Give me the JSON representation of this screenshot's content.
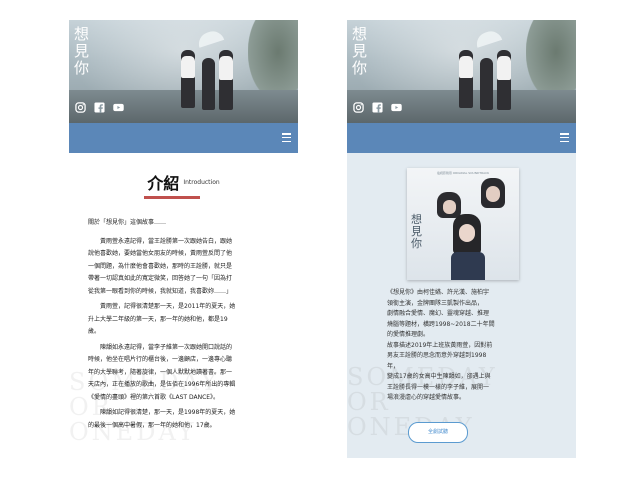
{
  "left_panel": {
    "hero": {
      "title": "想見你"
    },
    "section": {
      "title": "介紹",
      "subtitle": "Introduction"
    },
    "intro_lead": "關於「想見你」這個故事……",
    "paragraphs": [
      "黃雨萱永遠記得，當王詮勝第一次跟她告白，跟她\n說他喜歡她，要她當他女朋友的時候，黃雨萱反問了他\n一個問題，為什麼他會喜歡她，那時的王詮勝，就只是\n帶著一切認真如此的寬定微笑，回答她了一句「因為打\n從我第一眼看到你的時候，我就知道，我喜歡妳……」",
      "黃雨萱，記得很清楚那一天，是2011年的夏天，她\n升上大學二年級的第一天，那一年的她和他，都是19\n歲。",
      "陳韻如永遠記得，當李子維第一次跟她開口說話的\n時候，他坐在唱片行的櫃台後，一邊顧店，一邊專心聽\n年的大學聯考，隨著旋律，一個人默默地讀著書。那一\n天店內，正在播放的歌曲，是伍佰在1996年所出的專輯\n《愛情的盡頭》裡的第六首歌《LAST DANCE》。",
      "陳韻如記得很清楚，那一天，是1998年的夏天，她\n的最後一個高中暑假，那一年的她和他，17歲。"
    ],
    "watermark": "SOMEDAY\nOR\nONEDAY"
  },
  "right_panel": {
    "hero": {
      "title": "想見你"
    },
    "album": {
      "header": "電視原聲帶 ORIGINAL SOUNDTRACK",
      "title": "想見你"
    },
    "synopsis": "《想見你》由柯佳嬿、許光漢、施柏宇\n領銜主演，金牌團隊三凱製作出品，\n劇情融合愛情、魔幻、靈魂穿越、推理\n燒腦等題材，橫跨1998~2018二十年間\n的愛情推理劇。\n故事描述2019年上班族黃雨萱，因對前\n男友王詮勝的思念而意外穿越到1998\n年，\n變成17歲的女高中生陳韻如，卻遇上與\n王詮勝長得一模一樣的李子維，展開一\n場浪漫虐心的穿越愛情故事。",
    "button_label": "全劇試聽",
    "watermark": "SOMEDAY\nOR\nONEDAY"
  },
  "colors": {
    "navbar": "#5b87b8",
    "accent_underline": "#c0504d",
    "button": "#5b9bd0"
  },
  "icons": [
    "instagram-icon",
    "facebook-icon",
    "youtube-icon",
    "menu-icon"
  ]
}
